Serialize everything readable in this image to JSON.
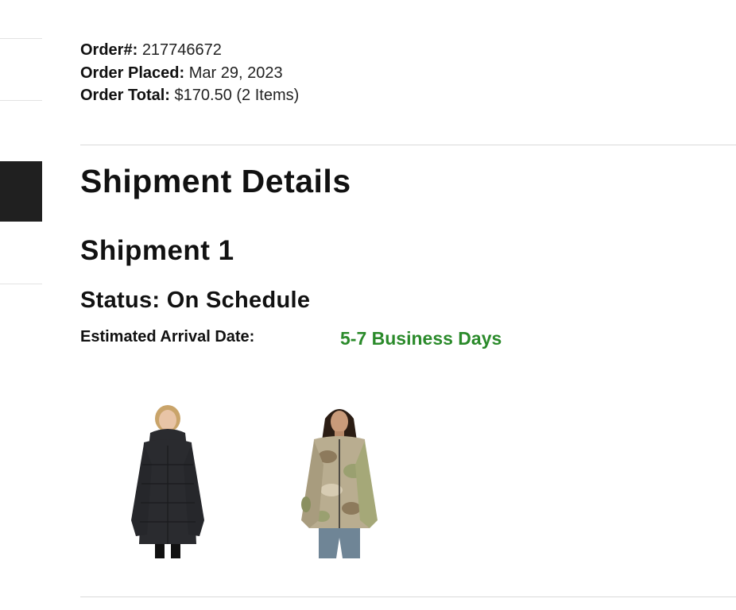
{
  "order": {
    "number_label": "Order#:",
    "number_value": "217746672",
    "placed_label": "Order Placed:",
    "placed_value": "Mar 29, 2023",
    "total_label": "Order Total:",
    "total_value": "$170.50 (2 Items)"
  },
  "shipment_details": {
    "heading": "Shipment Details",
    "shipment_title": "Shipment 1",
    "status": "Status: On Schedule",
    "arrival_label": "Estimated Arrival Date:",
    "arrival_value": "5-7 Business Days"
  },
  "products": [
    {
      "name": "black-long-puffer-jacket",
      "color": "#2a2b2f"
    },
    {
      "name": "camo-fleece-jacket",
      "color": "#b9ad90"
    }
  ],
  "colors": {
    "arrival_green": "#2a8a2a",
    "sidebar_active": "#202020"
  }
}
